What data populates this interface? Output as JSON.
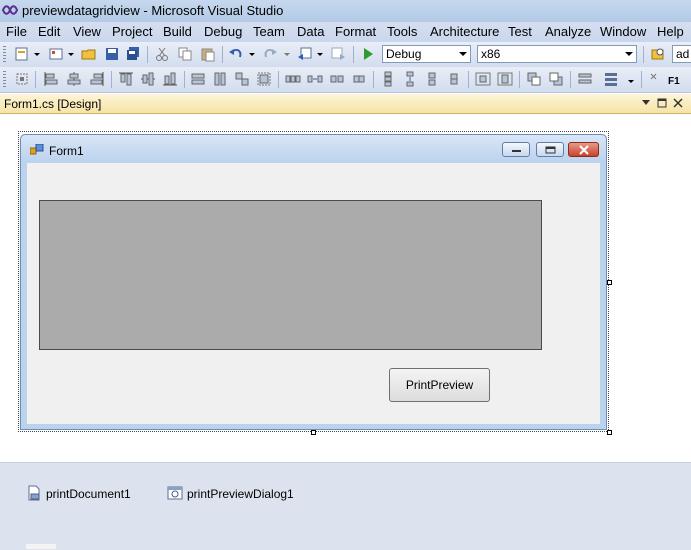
{
  "window": {
    "title": "previewdatagridview - Microsoft Visual Studio"
  },
  "menu": [
    "File",
    "Edit",
    "View",
    "Project",
    "Build",
    "Debug",
    "Team",
    "Data",
    "Format",
    "Tools",
    "Architecture",
    "Test",
    "Analyze",
    "Window",
    "Help"
  ],
  "toolbar": {
    "config_value": "Debug",
    "platform_value": "x86",
    "find_value": "ad",
    "help_label": "F1"
  },
  "doc_tab": {
    "label": "Form1.cs [Design]"
  },
  "form": {
    "title": "Form1",
    "button_label": "PrintPreview"
  },
  "tray": {
    "components": [
      {
        "name": "printDocument1",
        "icon": "print-document-icon"
      },
      {
        "name": "printPreviewDialog1",
        "icon": "print-preview-dialog-icon"
      }
    ]
  },
  "colors": {
    "titlebar": "#b3c9e6",
    "menubar": "#c9d6ec",
    "doc_tab": "#f6e4a6",
    "grid": "#ababab",
    "tray": "#dde3ee"
  }
}
